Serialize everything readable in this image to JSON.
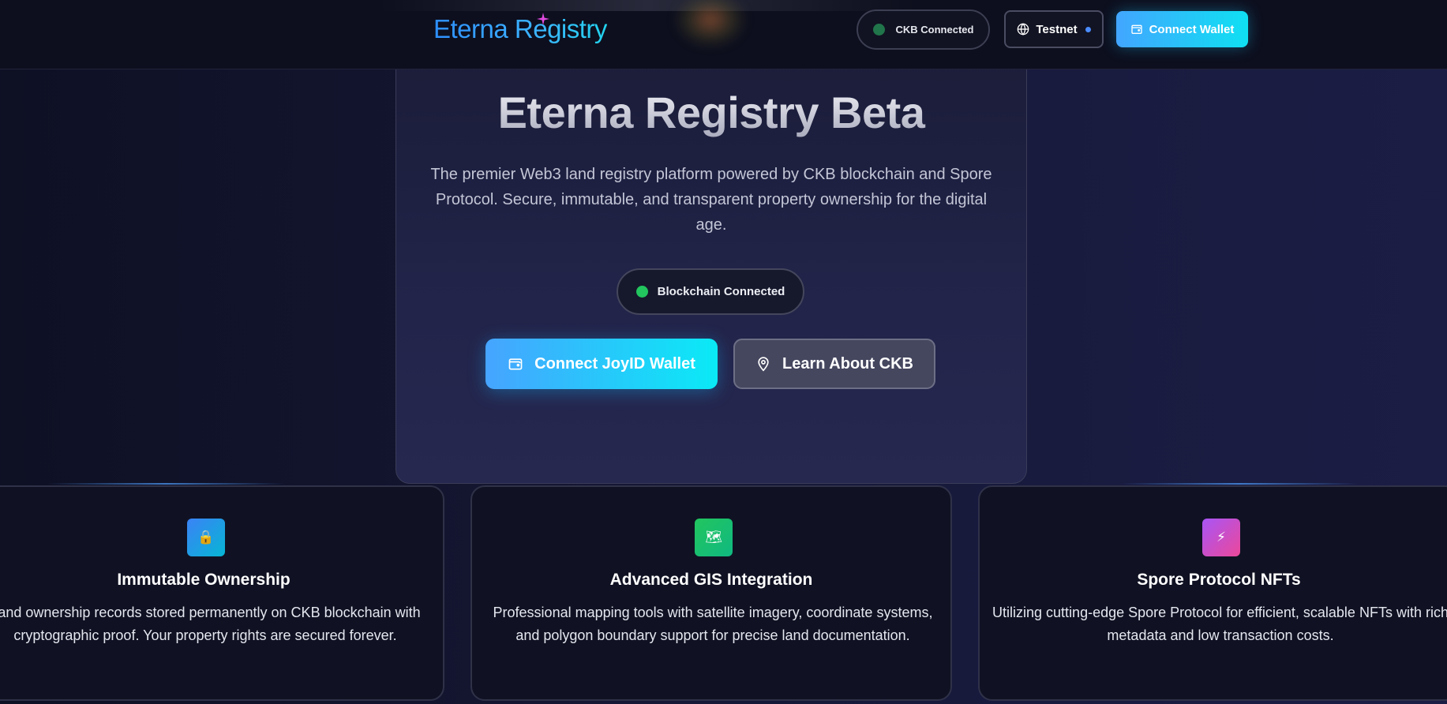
{
  "brand": {
    "logo_text": "Eterna Registry"
  },
  "nav": {
    "ckb_status": "CKB Connected",
    "network": "Testnet",
    "connect_wallet": "Connect Wallet"
  },
  "hero": {
    "title": "Eterna Registry Beta",
    "description": "The premier Web3 land registry platform powered by CKB blockchain and Spore Protocol. Secure, immutable, and transparent property ownership for the digital age.",
    "status": "Blockchain Connected",
    "primary_button": "Connect JoyID Wallet",
    "secondary_button": "Learn About CKB"
  },
  "features": [
    {
      "icon": "lock-icon",
      "icon_glyph": "🔒",
      "title": "Immutable Ownership",
      "description": "Land ownership records stored permanently on CKB blockchain with cryptographic proof. Your property rights are secured forever."
    },
    {
      "icon": "map-icon",
      "icon_glyph": "🗺",
      "title": "Advanced GIS Integration",
      "description": "Professional mapping tools with satellite imagery, coordinate systems, and polygon boundary support for precise land documentation."
    },
    {
      "icon": "lightning-icon",
      "icon_glyph": "⚡",
      "title": "Spore Protocol NFTs",
      "description": "Utilizing cutting-edge Spore Protocol for efficient, scalable NFTs with rich metadata and low transaction costs."
    }
  ],
  "colors": {
    "accent_start": "#42a6ff",
    "accent_end": "#0fe0f2",
    "status_green": "#22c55e",
    "background": "#141631"
  }
}
